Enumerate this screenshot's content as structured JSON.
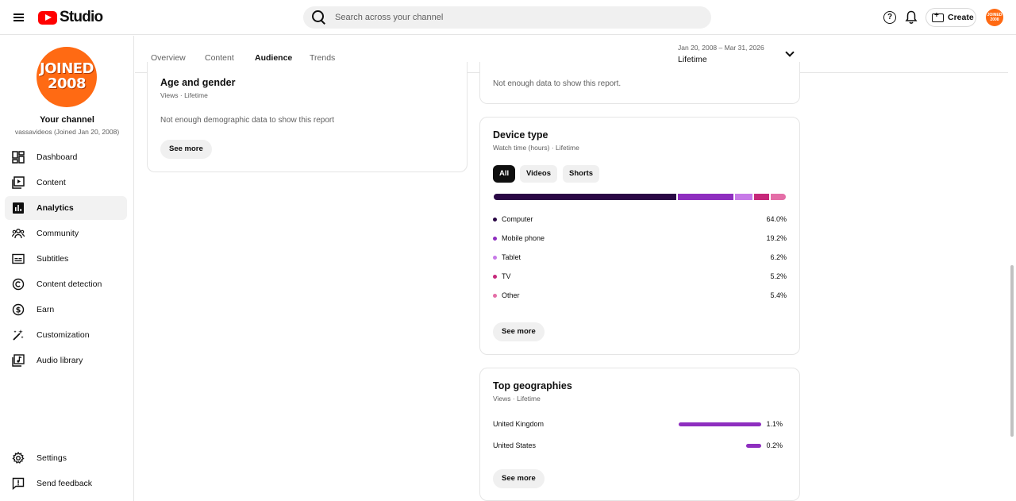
{
  "header": {
    "logo_text": "Studio",
    "search_placeholder": "Search across your channel",
    "create_label": "Create",
    "avatar_text": "JOINED 2008"
  },
  "channel": {
    "avatar_line1": "JOINED",
    "avatar_line2": "2008",
    "title": "Your channel",
    "subtitle": "vassavideos (Joined Jan 20, 2008)"
  },
  "sidebar": {
    "items": [
      {
        "label": "Dashboard",
        "icon": "dashboard-icon"
      },
      {
        "label": "Content",
        "icon": "content-icon"
      },
      {
        "label": "Analytics",
        "icon": "analytics-icon",
        "active": true
      },
      {
        "label": "Community",
        "icon": "community-icon"
      },
      {
        "label": "Subtitles",
        "icon": "subtitles-icon"
      },
      {
        "label": "Content detection",
        "icon": "copyright-icon"
      },
      {
        "label": "Earn",
        "icon": "dollar-icon"
      },
      {
        "label": "Customization",
        "icon": "magic-wand-icon"
      },
      {
        "label": "Audio library",
        "icon": "audio-library-icon"
      }
    ],
    "bottom": [
      {
        "label": "Settings",
        "icon": "gear-icon"
      },
      {
        "label": "Send feedback",
        "icon": "feedback-icon"
      }
    ]
  },
  "tabs": [
    "Overview",
    "Content",
    "Audience",
    "Trends"
  ],
  "active_tab": "Audience",
  "date_range": {
    "range": "Jan 20, 2008 – Mar 31, 2026",
    "label": "Lifetime"
  },
  "age_gender": {
    "title": "Age and gender",
    "subtitle": "Views · Lifetime",
    "message": "Not enough demographic data to show this report",
    "see_more": "See more"
  },
  "top_card": {
    "message": "Not enough data to show this report."
  },
  "device_type": {
    "title": "Device type",
    "subtitle": "Watch time (hours) · Lifetime",
    "chips": [
      "All",
      "Videos",
      "Shorts"
    ],
    "active_chip": "All",
    "see_more": "See more",
    "rows": [
      {
        "name": "Computer",
        "value": "64.0%",
        "share": 64.0,
        "color": "#2a0845"
      },
      {
        "name": "Mobile phone",
        "value": "19.2%",
        "share": 19.2,
        "color": "#8e2ebf"
      },
      {
        "name": "Tablet",
        "value": "6.2%",
        "share": 6.2,
        "color": "#c77ae8"
      },
      {
        "name": "TV",
        "value": "5.2%",
        "share": 5.2,
        "color": "#c6287a"
      },
      {
        "name": "Other",
        "value": "5.4%",
        "share": 5.4,
        "color": "#e46ea7"
      }
    ]
  },
  "top_geographies": {
    "title": "Top geographies",
    "subtitle": "Views · Lifetime",
    "see_more": "See more",
    "rows": [
      {
        "name": "United Kingdom",
        "value": "1.1%",
        "share": 1.1
      },
      {
        "name": "United States",
        "value": "0.2%",
        "share": 0.2
      }
    ]
  }
}
